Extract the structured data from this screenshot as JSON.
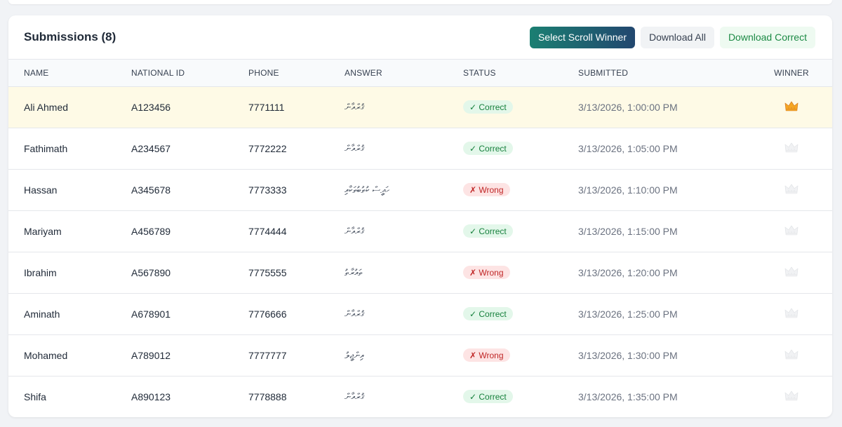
{
  "header": {
    "title": "Submissions (8)",
    "select_winner_label": "Select Scroll Winner",
    "download_all_label": "Download All",
    "download_correct_label": "Download Correct"
  },
  "columns": {
    "name": "NAME",
    "national_id": "NATIONAL ID",
    "phone": "PHONE",
    "answer": "ANSWER",
    "status": "STATUS",
    "submitted": "SUBMITTED",
    "winner": "WINNER"
  },
  "status_labels": {
    "correct": "✓ Correct",
    "wrong": "✗ Wrong"
  },
  "colors": {
    "accent": "#1f7a72",
    "correct": "#16803c",
    "wrong": "#c02626",
    "winner_highlight": "#fefae6",
    "crown_active": "#f5a623",
    "crown_inactive": "#e5e7eb"
  },
  "rows": [
    {
      "name": "Ali Ahmed",
      "national_id": "A123456",
      "phone": "7771111",
      "answer": "ޤުރްއާން",
      "status": "correct",
      "submitted": "3/13/2026, 1:00:00 PM",
      "winner": true
    },
    {
      "name": "Fathimath",
      "national_id": "A234567",
      "phone": "7772222",
      "answer": "ޤުރްއާން",
      "status": "correct",
      "submitted": "3/13/2026, 1:05:00 PM",
      "winner": false
    },
    {
      "name": "Hassan",
      "national_id": "A345678",
      "phone": "7773333",
      "answer": "ހަދީސް ކުތުބުތަކާއި",
      "status": "wrong",
      "submitted": "3/13/2026, 1:10:00 PM",
      "winner": false
    },
    {
      "name": "Mariyam",
      "national_id": "A456789",
      "phone": "7774444",
      "answer": "ޤުރްއާން",
      "status": "correct",
      "submitted": "3/13/2026, 1:15:00 PM",
      "winner": false
    },
    {
      "name": "Ibrahim",
      "national_id": "A567890",
      "phone": "7775555",
      "answer": "ތައުރާތު",
      "status": "wrong",
      "submitted": "3/13/2026, 1:20:00 PM",
      "winner": false
    },
    {
      "name": "Aminath",
      "national_id": "A678901",
      "phone": "7776666",
      "answer": "ޤުރްއާން",
      "status": "correct",
      "submitted": "3/13/2026, 1:25:00 PM",
      "winner": false
    },
    {
      "name": "Mohamed",
      "national_id": "A789012",
      "phone": "7777777",
      "answer": "އިންޖީލު",
      "status": "wrong",
      "submitted": "3/13/2026, 1:30:00 PM",
      "winner": false
    },
    {
      "name": "Shifa",
      "national_id": "A890123",
      "phone": "7778888",
      "answer": "ޤުރްއާން",
      "status": "correct",
      "submitted": "3/13/2026, 1:35:00 PM",
      "winner": false
    }
  ]
}
